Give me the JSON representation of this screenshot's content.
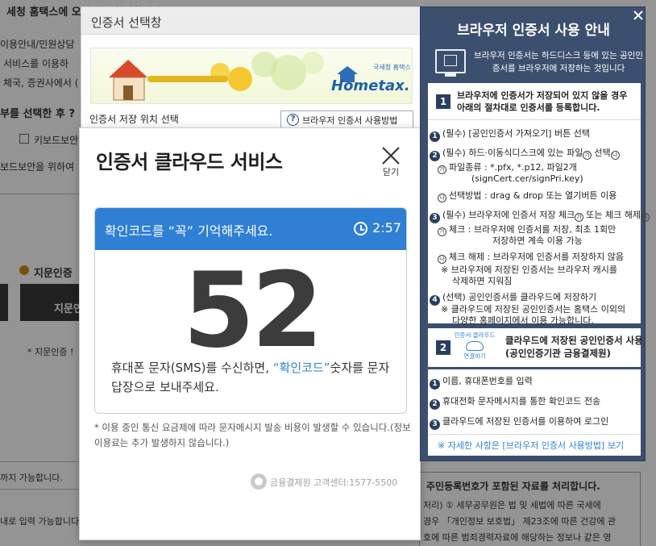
{
  "background": {
    "line1": "세청 홈택스에 오신것을 환영합니다",
    "line2": "이용안내/민원상담",
    "line3": "서비스를 이용하",
    "line4": "체국, 증권사에서 (",
    "line5": "부를 선택한 후 ?",
    "keyboard_label": "키보드보안",
    "line6": "보드보안을 위하여",
    "fingerprint_heading": "지문인증",
    "fingerprint_button": "지문인",
    "fingerprint_note": "* 지문인증 !",
    "possible1": "까지 가능합니다.",
    "possible2": "내로 입력 가능합니다.",
    "notice_heading": "주민등록번호가 포함된 자료를 처리합니다.",
    "notice_line1": "처리) ① 세무공무원은 법 및 세법에 따른 국세에",
    "notice_line2": "경우 「개인정보 보호법」 제23조에 따른 건강에 관",
    "notice_line3": "호에 따른 범죄경력자료에 해당하는 정보나 같은 영"
  },
  "cert_window": {
    "title": "인증서 선택창",
    "banner_brand": "Hometax.",
    "banner_brand_sub": "국세청 홈택스",
    "location_label": "인증서 저장 위치 선택",
    "guide_button": "브라우저 인증서 사용방법"
  },
  "cloud_modal": {
    "title": "인증서 클라우드 서비스",
    "close_label": "닫기",
    "header_text": "확인코드를 “꼭” 기억해주세요.",
    "timer": "2:57",
    "code": "52",
    "desc_part1": "휴대폰 문자(SMS)를 수신하면, ",
    "desc_highlight": "“확인코드”",
    "desc_part2": "숫자를 문자 답장으로 보내주세요.",
    "footnote": "* 이용 중인 통신 요금제에 따라 문자메시지 발송 비용이 발생할 수 있습니다.(정보이용료는 추가 발생하지 않습니다.)",
    "footer": "금융결제원 고객센터:1577-5500"
  },
  "guide_panel": {
    "title": "브라우저 인증서 사용 안내",
    "subtitle": "브라우저 인증서는 하드디스크 등에 있는 공인인증서를 브라우저에 저장하는 것입니다",
    "section1_num": "1",
    "section1_line1": "브라우저에 인증서가 저장되어 있지 않을 경우",
    "section1_line2": "아래의 절차대로 인증서를 등록합니다.",
    "steps": {
      "s1": "(필수) [공인인증서 가져오기] 버튼 선택",
      "s2": "(필수) 하드·이동식디스크에 있는 파일",
      "s2_tail": "선택",
      "s2a1": "파일종류 : *.pfx, *.p12, 파일2개",
      "s2a2": "(signCert.cer/signPri.key)",
      "s2b": "선택방법 : drag & drop 또는 열기버튼 이용",
      "s3": "(필수) 브라우저에 인증서 저장 체크",
      "s3_tail": "또는 체크 해제",
      "s3a1": "체크 : 브라우저에 인증서를 저장, 최초 1회만",
      "s3a2": "저장하면 계속 이용 가능",
      "s3b": "체크 해제 : 브라우저에 인증서를 저장하지 않음",
      "s3c1": "※ 브라우저에 저장된 인증서는 브라우저 캐시를",
      "s3c2": "삭제하면 지워짐",
      "s4": "(선택) 공인인증서를 클라우드에 저장하기",
      "s4a1": "※ 클라우드에 저장된 공인인증서는 홈택스 이외의",
      "s4a2": "다양한 홈페이지에서 이용 가능합니다."
    },
    "section2_num": "2",
    "section2_badge_top": "인증서 클라우드",
    "section2_badge_bottom": "연결하기",
    "section2_line1": "클라우드에 저장된 공인인증서 사용",
    "section2_line2": "(공인인증기관 금융결제원)",
    "section2_steps": {
      "t1": "이름, 휴대폰번호를 입력",
      "t2": "휴대전화 문자메시지를 통한 확인코드 전송",
      "t3": "클라우드에 저장된 인증서를 이용하여 로그인"
    },
    "detail_link": "※ 자세한 사항은 [브라우저 인증서 사용방법] 보기"
  }
}
